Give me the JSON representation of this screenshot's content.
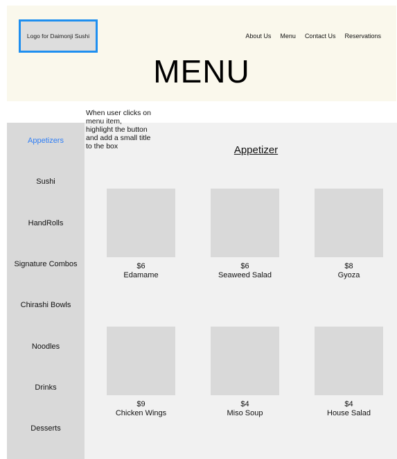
{
  "header": {
    "logo_text": "Logo for Daimonji Sushi",
    "nav": [
      "About Us",
      "Menu",
      "Contact Us",
      "Reservations"
    ],
    "title": "MENU"
  },
  "annotation_note": "When user clicks on\nmenu item,\nhighlight the button\nand add a small title\nto the box",
  "sidebar": {
    "items": [
      "Appetizers",
      "Sushi",
      "HandRolls",
      "Signature Combos",
      "Chirashi Bowls",
      "Noodles",
      "Drinks",
      "Desserts"
    ],
    "active_index": 0
  },
  "main": {
    "section_title": "Appetizer",
    "items": [
      {
        "price": "$6",
        "name": "Edamame"
      },
      {
        "price": "$6",
        "name": "Seaweed Salad"
      },
      {
        "price": "$8",
        "name": "Gyoza"
      },
      {
        "price": "$9",
        "name": "Chicken Wings"
      },
      {
        "price": "$4",
        "name": "Miso Soup"
      },
      {
        "price": "$4",
        "name": "House Salad"
      }
    ]
  },
  "colors": {
    "header_bg": "#faf8ec",
    "logo_border": "#1e8ff0",
    "active_item": "#2f7ef5",
    "sidebar_bg": "#d9d9d9",
    "main_bg": "#f1f1f1",
    "placeholder": "#d9d9d9"
  }
}
